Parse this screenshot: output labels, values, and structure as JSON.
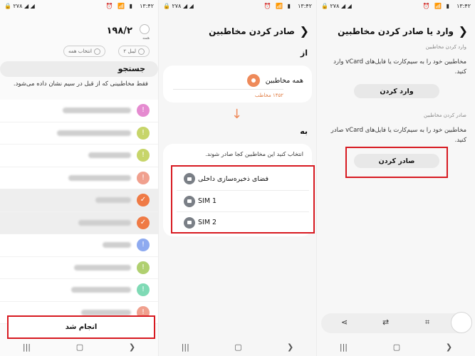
{
  "status": {
    "time": "۱۳:۴۲",
    "left_icons": "🔒 ۲۷۸ ◢ ◢",
    "sys_icons": "⏰ 📶 ▮"
  },
  "panel1": {
    "title": "۱۹۸/۲",
    "radio_label": "همه",
    "chips": [
      "انتخاب همه",
      "لیبل ۲"
    ],
    "search_label": "جستجو",
    "note": "فقط مخاطبینی که از قبل در سیم نشان داده می‌شود.",
    "contacts": [
      {
        "initial": "!",
        "color": "#e58bd0",
        "selected": false
      },
      {
        "initial": "!",
        "color": "#c7d56a",
        "selected": false
      },
      {
        "initial": "!",
        "color": "#c7d56a",
        "selected": false
      },
      {
        "initial": "!",
        "color": "#f0a08e",
        "selected": false
      },
      {
        "initial": "✓",
        "color": "#ef7a45",
        "selected": true
      },
      {
        "initial": "✓",
        "color": "#ef7a45",
        "selected": true
      },
      {
        "initial": "!",
        "color": "#8eaaf0",
        "selected": false
      },
      {
        "initial": "!",
        "color": "#b0d070",
        "selected": false
      },
      {
        "initial": "!",
        "color": "#7fdab5",
        "selected": false
      },
      {
        "initial": "!",
        "color": "#f0a08e",
        "selected": false
      }
    ],
    "done_label": "انجام شد"
  },
  "panel2": {
    "title": "صادر کردن مخاطبین",
    "from_label": "از",
    "source_name": "همه مخاطبین",
    "source_count": "۱۴۵۲ مخاطب",
    "to_label": "به",
    "dest_hint": "انتخاب کنید این مخاطبین کجا صادر شوند.",
    "destinations": [
      "فضای ذخیره‌سازی داخلی",
      "SIM 1",
      "SIM 2"
    ]
  },
  "panel3": {
    "title": "وارد یا صادر کردن مخاطبین",
    "import_heading": "وارد کردن مخاطبین",
    "import_desc": "مخاطبین خود را به سیم‌کارت یا فایل‌های vCard وارد کنید.",
    "import_button": "وارد کردن",
    "export_heading": "صادر کردن مخاطبین",
    "export_desc": "مخاطبین خود را به سیم‌کارت یا فایل‌های vCard صادر کنید.",
    "export_button": "صادر کردن"
  },
  "icons": {
    "back": "❮",
    "arrow_down": "↓",
    "share": "⋖",
    "nav_recent": "|||",
    "nav_home": "▢",
    "nav_back": "❯"
  }
}
